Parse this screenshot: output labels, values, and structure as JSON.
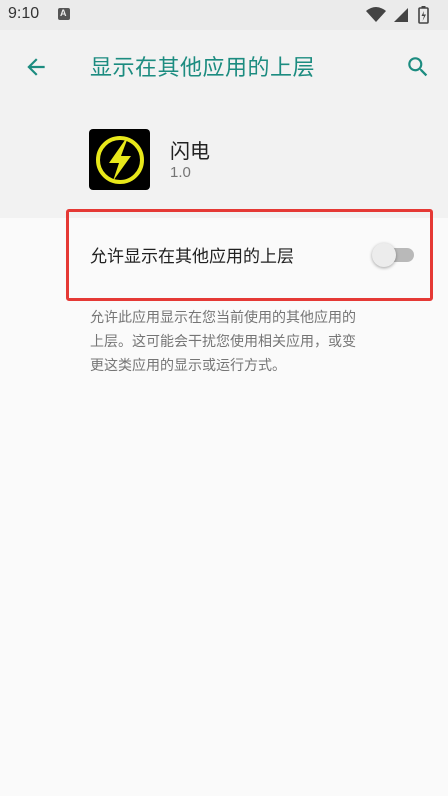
{
  "status_bar": {
    "time": "9:10",
    "notification_icon": "A"
  },
  "app_bar": {
    "title": "显示在其他应用的上层",
    "back_icon": "arrow-left-icon",
    "search_icon": "search-icon",
    "accent_color": "#1c8c80"
  },
  "app": {
    "name": "闪电",
    "version": "1.0",
    "icon": "lightning-bolt-icon"
  },
  "setting": {
    "label": "允许显示在其他应用的上层",
    "enabled": false,
    "description_lines": [
      "允许此应用显示在您当前使用的其他应用的",
      "上层。这可能会干扰您使用相关应用，或变",
      "更这类应用的显示或运行方式。"
    ]
  },
  "highlight_color": "#e53935"
}
